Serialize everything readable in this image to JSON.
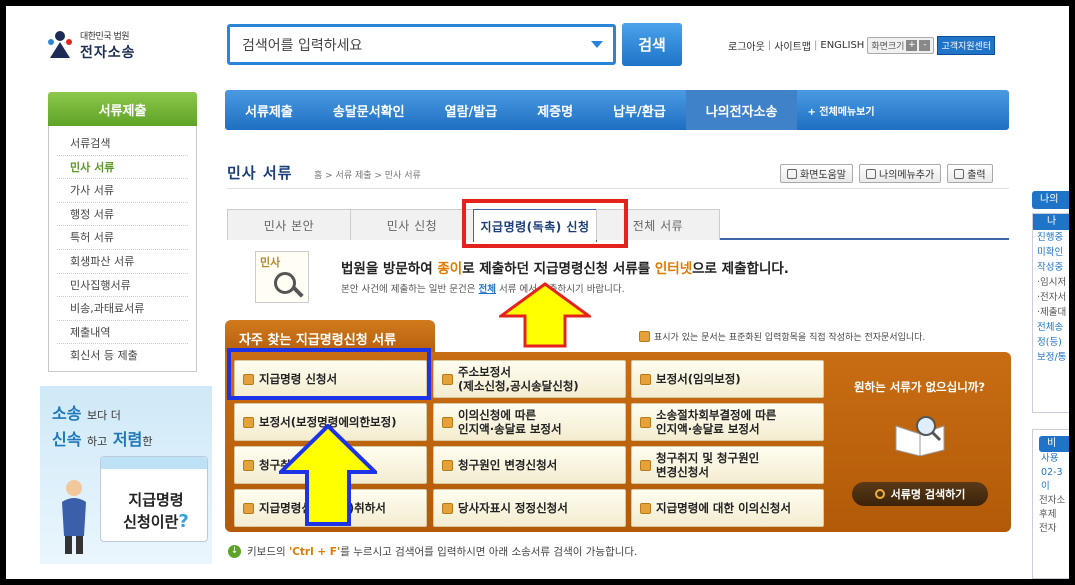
{
  "header": {
    "logo_small": "대한민국 법원",
    "logo_big": "전자소송",
    "search_placeholder": "검색어를 입력하세요",
    "search_button": "검색",
    "util_links": [
      "로그아웃",
      "사이트맵",
      "ENGLISH"
    ],
    "font_size_label": "화면크기",
    "font_plus": "+",
    "font_minus": "-",
    "customer_center": "고객지원센터"
  },
  "nav": {
    "items": [
      "서류제출",
      "송달문서확인",
      "열람/발급",
      "제증명",
      "납부/환급",
      "나의전자소송"
    ],
    "all_menu": "+ 전체메뉴보기"
  },
  "sidebar": {
    "title": "서류제출",
    "items": [
      "서류검색",
      "민사 서류",
      "가사 서류",
      "행정 서류",
      "특허 서류",
      "회생파산 서류",
      "민사집행서류",
      "비송,과태료서류",
      "제출내역",
      "회신서 등 제출"
    ]
  },
  "banner": {
    "line1_big": "소송",
    "line1_small": "보다 더",
    "line2_a": "신속",
    "line2_b": "하고",
    "line2_c": "저렴",
    "line2_d": "한",
    "title1": "지급명령",
    "title2": "신청이란",
    "q": "?"
  },
  "page": {
    "title": "민사 서류",
    "breadcrumb": "홈 > 서류 제출 > 민사 서류",
    "tools": [
      "화면도움말",
      "나의메뉴추가",
      "출력"
    ],
    "tabs": [
      "민사 본안",
      "민사 신청",
      "지급명령(독촉) 신청",
      "전체 서류"
    ],
    "active_tab": 2,
    "intro_icon_label": "민사",
    "intro_main_1": "법원을 방문하여 ",
    "intro_main_2": "종이",
    "intro_main_3": "로 제출하던 지급명령신청 서류를 ",
    "intro_main_4": "인터넷",
    "intro_main_5": "으로 제출합니다.",
    "intro_sub_1": "본안 사건에 제출하는 일반 문건은 ",
    "intro_sub_2": "전체",
    "intro_sub_3": " 서류 에서 제출하시기 바랍니다."
  },
  "frequent": {
    "title": "자주 찾는 지급명령신청 서류",
    "note": "표시가 있는 문서는 표준화된 입력항목을 직접 작성하는 전자문서입니다.",
    "docs": [
      "지급명령 신청서",
      "주소보정서\n(제소신청,공시송달신청)",
      "보정서(임의보정)",
      "보정서(보정명령에의한보정)",
      "이의신청에 따른\n인지액·송달료 보정서",
      "소송절차회부결정에 따른\n인지액·송달료 보정서",
      "청구취지 변경신청서",
      "청구원인 변경신청서",
      "청구취지 및 청구원인\n변경신청서",
      "지급명령신청(일부)취하서",
      "당사자표시 정정신청서",
      "지급명령에 대한 이의신청서"
    ],
    "no_doc_question": "원하는 서류가 없으십니까?",
    "search_doc_button": "서류명 검색하기"
  },
  "hint": {
    "pre": "키보드의 ",
    "key": "'Ctrl + F'",
    "post": "를 누르시고 검색어를 입력하시면 아래 소송서류 검색이 가능합니다."
  },
  "right_column": {
    "tab1": "나의",
    "box_head": "나",
    "lines": [
      "진행중",
      "미확인",
      "작성중",
      "·임시저",
      "·전자서",
      "·제출대",
      "전체송",
      "정(등)",
      "보정/통"
    ],
    "box2_head": "비",
    "box2_lines": [
      "사용",
      "02-3",
      "이",
      "전자소",
      "후제",
      "전자"
    ]
  },
  "colors": {
    "nav_blue": "#1f6fc2",
    "sidebar_green": "#5ea327",
    "panel_orange": "#c86d13",
    "annotation_red": "#e5231e",
    "annotation_blue": "#1c33e8",
    "arrow_yellow": "#ffff00"
  }
}
